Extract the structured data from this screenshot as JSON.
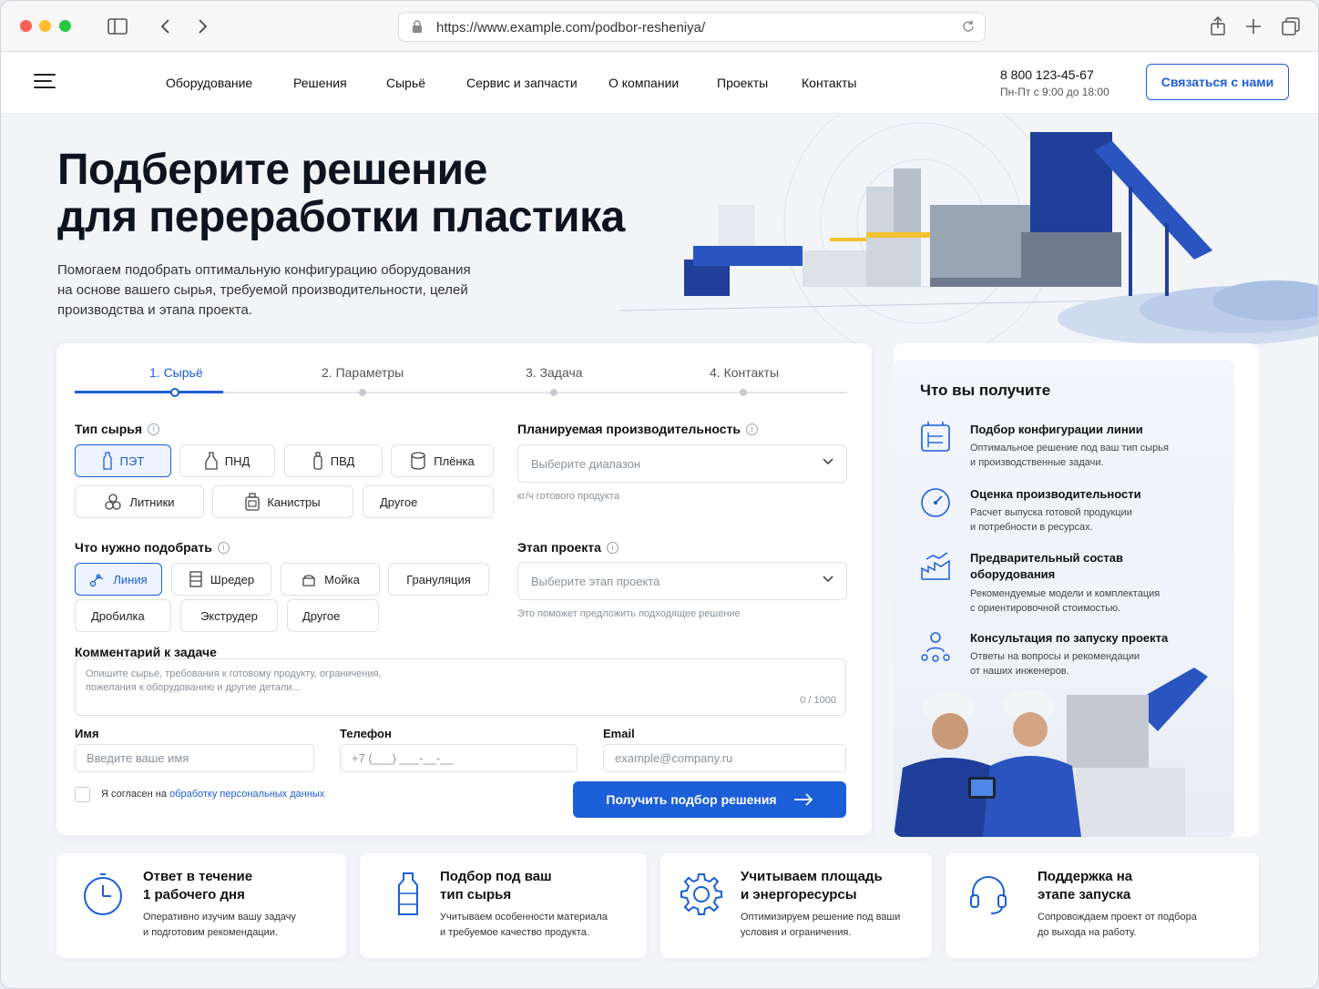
{
  "browser": {
    "url": "https://www.example.com/podbor-resheniya/"
  },
  "header": {
    "nav": [
      "Оборудование",
      "Решения",
      "Сырьё",
      "Сервис и запчасти",
      "О компании",
      "Проекты",
      "Контакты"
    ],
    "phone": "8 800 123-45-67",
    "hours": "Пн-Пт с 9:00 до 18:00",
    "contact_button": "Связаться с нами"
  },
  "hero": {
    "title_line1": "Подберите решение",
    "title_line2": "для переработки пластика",
    "subtitle": "Помогаем подобрать оптимальную конфигурацию оборудования на основе вашего сырья, требуемой производительности, целей производства и этапа проекта."
  },
  "form": {
    "steps": [
      "1. Сырьё",
      "2. Параметры",
      "3. Задача",
      "4. Контакты"
    ],
    "active_step": 0,
    "raw_type": {
      "label": "Тип сырья",
      "options": [
        "ПЭТ",
        "ПНД",
        "ПВД",
        "Плёнка",
        "Литники",
        "Канистры",
        "Другое"
      ],
      "selected": "ПЭТ"
    },
    "capacity": {
      "label": "Планируемая производительность",
      "placeholder": "Выберите диапазон",
      "hint": "кг/ч готового продукта"
    },
    "need": {
      "label": "Что нужно подобрать",
      "options": [
        "Линия",
        "Шредер",
        "Мойка",
        "Грануляция",
        "Дробилка",
        "Экструдер",
        "Другое"
      ],
      "selected": "Линия"
    },
    "stage": {
      "label": "Этап проекта",
      "placeholder": "Выберите этап проекта",
      "hint": "Это поможет предложить подходящее решение"
    },
    "comment": {
      "label": "Комментарий к задаче",
      "placeholder_line1": "Опишите сырье, требования к готовому продукту, ограничения,",
      "placeholder_line2": "пожелания к оборудованию и другие детали...",
      "counter": "0 / 1000"
    },
    "name": {
      "label": "Имя",
      "placeholder": "Введите ваше имя"
    },
    "phone": {
      "label": "Телефон",
      "placeholder": "+7 (___) ___-__-__"
    },
    "email": {
      "label": "Email",
      "placeholder": "example@company.ru"
    },
    "consent_prefix": "Я согласен на",
    "consent_link": "обработку персональных данных",
    "submit": "Получить подбор решения"
  },
  "benefits": {
    "title": "Что вы получите",
    "items": [
      {
        "title": "Подбор конфигурации линии",
        "desc1": "Оптимальное решение под ваш тип сырья",
        "desc2": "и производственные задачи."
      },
      {
        "title": "Оценка производительности",
        "desc1": "Расчет выпуска готовой продукции",
        "desc2": "и потребности в ресурсах."
      },
      {
        "title": "Предварительный состав",
        "title2": "оборудования",
        "desc1": "Рекомендуемые модели и комплектация",
        "desc2": "с ориентировочной стоимостью."
      },
      {
        "title": "Консультация по запуску проекта",
        "desc1": "Ответы на вопросы и рекомендации",
        "desc2": "от наших инженеров."
      }
    ]
  },
  "features": [
    {
      "title1": "Ответ в течение",
      "title2": "1 рабочего дня",
      "desc1": "Оперативно изучим вашу задачу",
      "desc2": "и подготовим рекомендации.",
      "icon": "clock-icon"
    },
    {
      "title1": "Подбор под ваш",
      "title2": "тип сырья",
      "desc1": "Учитываем особенности материала",
      "desc2": "и требуемое качество продукта.",
      "icon": "bottle-icon"
    },
    {
      "title1": "Учитываем площадь",
      "title2": "и энергоресурсы",
      "desc1": "Оптимизируем решение под ваши",
      "desc2": "условия и ограничения.",
      "icon": "gear-icon"
    },
    {
      "title1": "Поддержка на",
      "title2": "этапе запуска",
      "desc1": "Сопровождаем проект от подбора",
      "desc2": "до выхода на работу.",
      "icon": "headset-icon"
    }
  ],
  "colors": {
    "accent": "#1b5ed8",
    "text": "#111827",
    "muted": "#8a919c"
  }
}
